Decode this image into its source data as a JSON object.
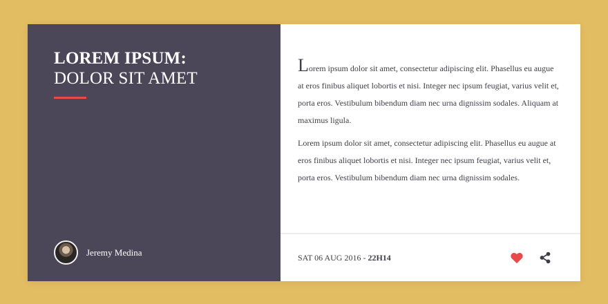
{
  "card": {
    "title_strong": "LOREM IPSUM:",
    "title_light": "DOLOR SIT AMET",
    "accent_color": "#e84a4a",
    "author": {
      "name": "Jeremy Medina",
      "avatar_icon": "user-photo"
    },
    "body": {
      "dropcap": "L",
      "paragraph1_rest": "orem ipsum dolor sit amet, consectetur adipiscing elit. Phasellus eu augue at eros finibus aliquet lobortis et nisi. Integer nec ipsum feugiat, varius velit et, porta eros. Vestibulum bibendum diam nec urna dignissim sodales. Aliquam at maximus ligula.",
      "paragraph2": "Lorem ipsum dolor sit amet, consectetur adipiscing elit. Phasellus eu augue at eros finibus aliquet lobortis et nisi. Integer nec ipsum feugiat, varius velit et, porta eros. Vestibulum bibendum diam nec urna dignissim sodales."
    },
    "footer": {
      "date": "SAT 06 AUG 2016 - ",
      "time": "22H14",
      "like_icon": "heart-icon",
      "share_icon": "share-icon"
    }
  },
  "colors": {
    "background": "#e3bd62",
    "left_panel": "#4b4658",
    "heart": "#e84a4a",
    "share": "#3e3e48"
  }
}
